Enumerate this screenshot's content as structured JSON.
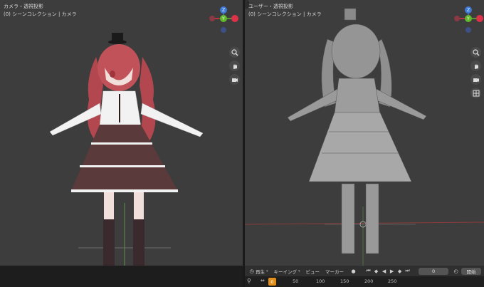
{
  "left_viewport": {
    "view_title": "カメラ・透視投影",
    "collection_label": "(0) シーンコレクション | カメラ"
  },
  "right_viewport": {
    "view_title": "ユーザー・透視投影",
    "collection_label": "(0) シーンコレクション | カメラ"
  },
  "gizmo": {
    "z_label": "Z",
    "y_label": "Y",
    "x_label": "X",
    "colors": {
      "x": "#e0314a",
      "y": "#60b82a",
      "z": "#3e7ad6",
      "neg_x": "#8a3a44",
      "neg_y": "#4f7b35",
      "neg_z": "#3e4f86"
    }
  },
  "nav_icons": [
    "zoom-icon",
    "hand-icon",
    "camera-icon",
    "grid-icon"
  ],
  "timeline": {
    "menus": [
      {
        "label": "再生"
      },
      {
        "label": "キーイング"
      },
      {
        "label": "ビュー"
      },
      {
        "label": "マーカー"
      }
    ],
    "current_frame": "0",
    "start_label": "開始",
    "ruler_labels": [
      "0",
      "50",
      "100",
      "150",
      "200",
      "250"
    ]
  }
}
